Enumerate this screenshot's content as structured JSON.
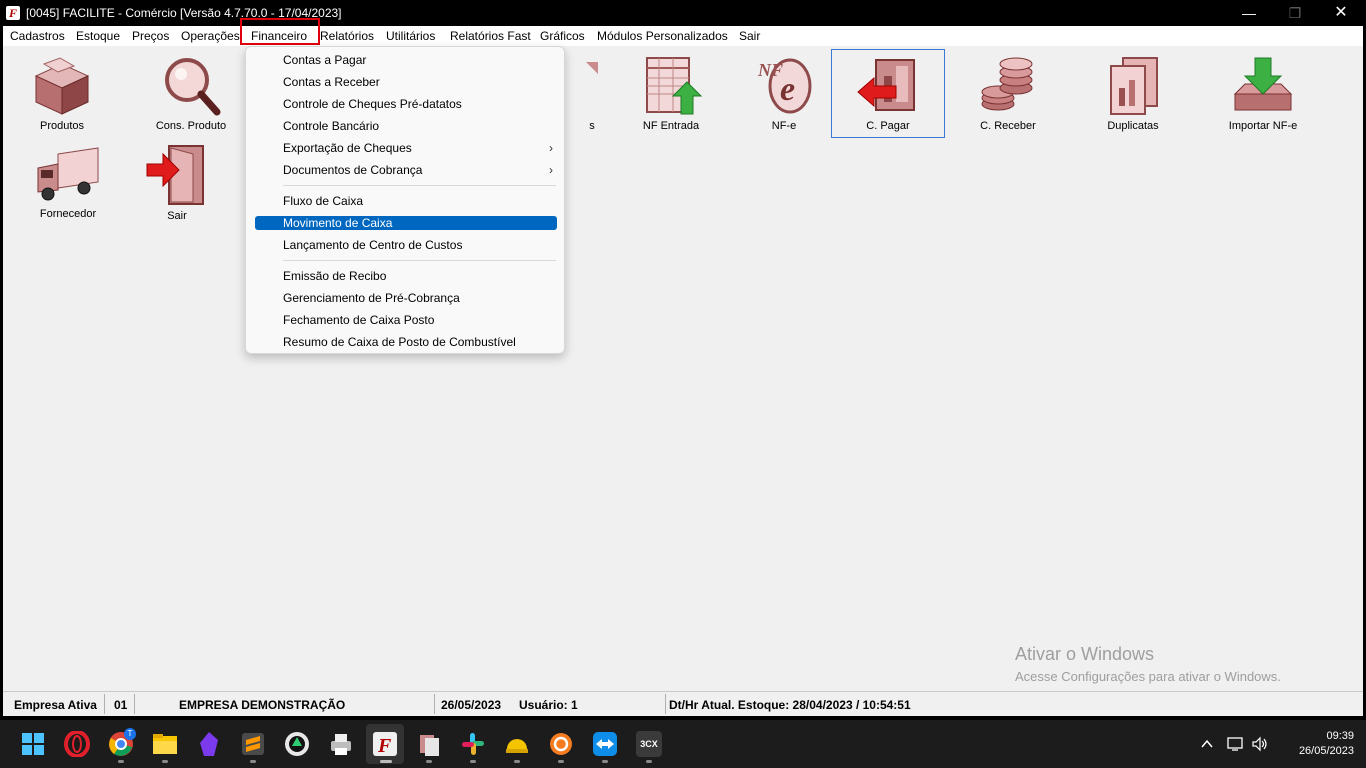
{
  "window": {
    "title": "[0045] FACILITE - Comércio [Versão 4.7.70.0 - 17/04/2023]",
    "app_icon_letter": "F",
    "minimize_glyph": "—",
    "maximize_glyph": "❐",
    "close_glyph": "✕"
  },
  "menubar": {
    "items": [
      "Cadastros",
      "Estoque",
      "Preços",
      "Operações",
      "Financeiro",
      "Relatórios",
      "Utilitários",
      "Relatórios Fast",
      "Gráficos",
      "Módulos Personalizados",
      "Sair"
    ],
    "open_item": "Financeiro"
  },
  "toolbar": {
    "items": [
      {
        "label": "Produtos",
        "icon": "box-icon"
      },
      {
        "label": "Cons. Produto",
        "icon": "magnifier-icon"
      },
      {
        "label": "s",
        "icon": "hidden-icon"
      },
      {
        "label": "NF Entrada",
        "icon": "invoice-in-icon"
      },
      {
        "label": "NF-e",
        "icon": "nfe-icon"
      },
      {
        "label": "C. Pagar",
        "icon": "payable-icon"
      },
      {
        "label": "C. Receber",
        "icon": "coins-icon"
      },
      {
        "label": "Duplicatas",
        "icon": "duplicates-icon"
      },
      {
        "label": "Importar NF-e",
        "icon": "import-icon"
      },
      {
        "label": "Fornecedor",
        "icon": "truck-icon"
      },
      {
        "label": "Sair",
        "icon": "exit-door-icon"
      }
    ],
    "selected": "C. Pagar"
  },
  "dropdown": {
    "groups": [
      [
        {
          "label": "Contas a Pagar",
          "submenu": false
        },
        {
          "label": "Contas a Receber",
          "submenu": false
        },
        {
          "label": "Controle de Cheques Pré-datatos",
          "submenu": false
        },
        {
          "label": "Controle Bancário",
          "submenu": false
        },
        {
          "label": "Exportação de Cheques",
          "submenu": true
        },
        {
          "label": "Documentos de Cobrança",
          "submenu": true
        }
      ],
      [
        {
          "label": "Fluxo de Caixa",
          "submenu": false
        },
        {
          "label": "Movimento de Caixa",
          "submenu": false,
          "highlighted": true
        },
        {
          "label": "Lançamento de Centro de Custos",
          "submenu": false
        }
      ],
      [
        {
          "label": "Emissão de Recibo",
          "submenu": false
        },
        {
          "label": "Gerenciamento de Pré-Cobrança",
          "submenu": false
        },
        {
          "label": "Fechamento de Caixa Posto",
          "submenu": false
        },
        {
          "label": "Resumo de Caixa de Posto de Combustível",
          "submenu": false
        }
      ]
    ],
    "submenu_glyph": "›"
  },
  "watermark": {
    "title": "Ativar o Windows",
    "subtitle": "Acesse Configurações para ativar o Windows."
  },
  "statusbar": {
    "label_empresa": "Empresa Ativa",
    "codigo": "01",
    "empresa": "EMPRESA DEMONSTRAÇÃO",
    "data": "26/05/2023",
    "usuario": "Usuário: 1",
    "estoque": "Dt/Hr Atual. Estoque: 28/04/2023 / 10:54:51"
  },
  "taskbar": {
    "apps": [
      "windows-start-icon",
      "opera-icon",
      "chrome-icon",
      "file-explorer-icon",
      "obsidian-icon",
      "sublime-icon",
      "browser-icon",
      "printer-icon",
      "facilite-icon",
      "files-app-icon",
      "slack-icon",
      "helmet-app-icon",
      "sync-icon",
      "teamviewer-icon",
      "3cx-icon"
    ],
    "chrome_badge": "T",
    "cx_label": "3CX",
    "tray_icons": [
      "chevron-up-icon",
      "network-icon",
      "volume-icon"
    ],
    "time": "09:39",
    "date": "26/05/2023"
  },
  "colors": {
    "accent": "#0067c0",
    "highlight_box": "#e0000b",
    "icon_pink": "#c98b8b",
    "icon_dark": "#7a3333"
  }
}
